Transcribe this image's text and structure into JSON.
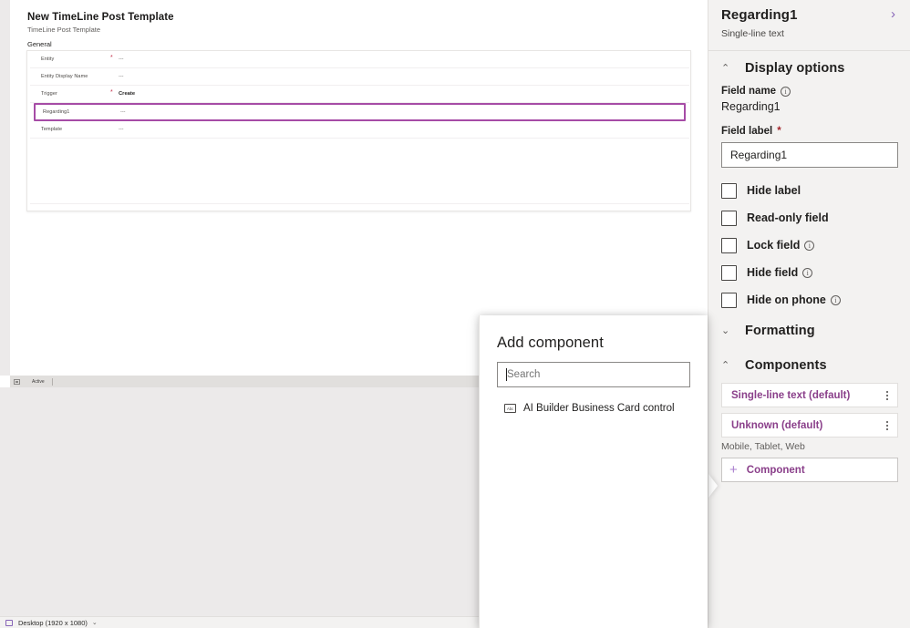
{
  "designer": {
    "form_title": "New TimeLine Post Template",
    "form_subtitle": "TimeLine Post Template",
    "tab_label": "General",
    "rows": [
      {
        "label": "Entity",
        "required": "*",
        "value": "---"
      },
      {
        "label": "Entity Display Name",
        "required": "",
        "value": "---"
      },
      {
        "label": "Trigger",
        "required": "*",
        "value": "Create"
      },
      {
        "label": "Regarding1",
        "required": "",
        "value": "---"
      },
      {
        "label": "Template",
        "required": "",
        "value": "---"
      }
    ],
    "status_text": "Active"
  },
  "bottom_bar": {
    "screen_size_label": "Desktop (1920 x 1080)",
    "chevron": "⌄"
  },
  "flyout": {
    "title": "Add component",
    "search_placeholder": "Search",
    "search_value": "",
    "items": [
      {
        "icon_label": "Abc",
        "label": "AI Builder Business Card control"
      }
    ]
  },
  "properties": {
    "title": "Regarding1",
    "subtitle": "Single-line text",
    "expand_chevron": "›",
    "display_options": {
      "section_label": "Display options",
      "caret": "⌃",
      "field_name_label": "Field name",
      "field_name_value": "Regarding1",
      "field_label_label": "Field label",
      "field_label_required": "*",
      "field_label_value": "Regarding1",
      "field_label_placeholder": "",
      "checkboxes": [
        {
          "label": "Hide label",
          "info": false
        },
        {
          "label": "Read-only field",
          "info": false
        },
        {
          "label": "Lock field",
          "info": true
        },
        {
          "label": "Hide field",
          "info": true
        },
        {
          "label": "Hide on phone",
          "info": true
        }
      ]
    },
    "formatting": {
      "section_label": "Formatting",
      "caret": "⌄"
    },
    "components": {
      "section_label": "Components",
      "caret": "⌃",
      "items": [
        {
          "label": "Single-line text (default)",
          "sub": ""
        },
        {
          "label": "Unknown (default)",
          "sub": "Mobile, Tablet, Web"
        }
      ],
      "add_label": "Component",
      "add_icon": "+"
    }
  },
  "colors": {
    "accent_purple": "#8a3f8a",
    "panel_bg": "#f3f2f1",
    "selection_border": "#a64ca6",
    "required_red": "#a4262c"
  }
}
